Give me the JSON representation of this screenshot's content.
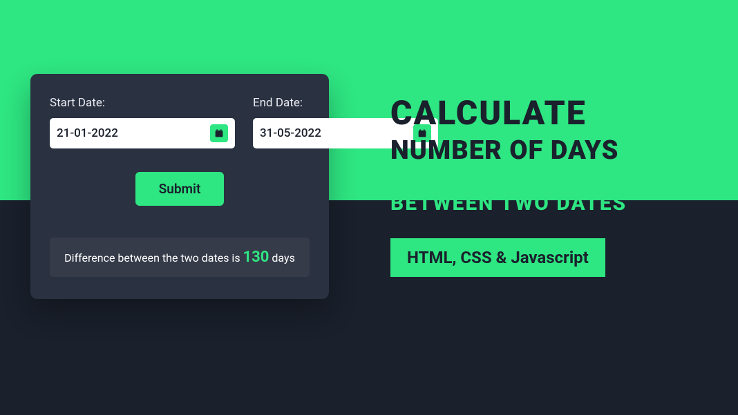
{
  "form": {
    "start_label": "Start Date:",
    "start_value": "21-01-2022",
    "end_label": "End Date:",
    "end_value": "31-05-2022",
    "submit_label": "Submit",
    "result_prefix": "Difference between the two dates is ",
    "result_number": "130",
    "result_suffix": " days"
  },
  "title": {
    "line1": "CALCULATE",
    "line2": "NUMBER OF DAYS",
    "line3": "BETWEEN TWO DATES",
    "badge": "HTML, CSS & Javascript"
  }
}
